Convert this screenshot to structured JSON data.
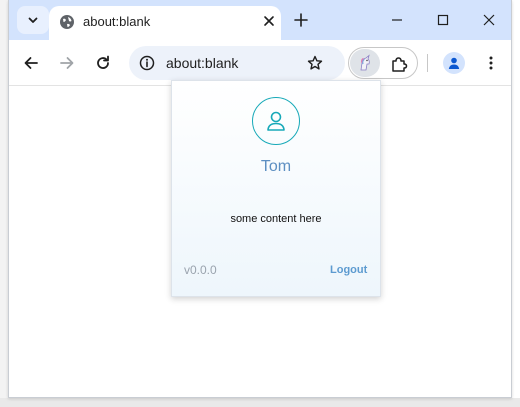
{
  "browser": {
    "tab": {
      "title": "about:blank",
      "icon": "globe-icon"
    },
    "omnibox": {
      "url": "about:blank"
    },
    "toolbar_icons": {
      "back": "arrow-left-icon",
      "forward": "arrow-right-icon",
      "reload": "reload-icon",
      "site_info": "info-icon",
      "bookmark": "star-icon",
      "extension": "unicorn-extension-icon",
      "extensions_menu": "puzzle-icon",
      "profile": "person-icon",
      "menu": "kebab-menu-icon"
    }
  },
  "popup": {
    "user_name": "Tom",
    "content_text": "some content here",
    "version": "v0.0.0",
    "logout_label": "Logout"
  },
  "colors": {
    "tabstrip_bg": "#d3e3fd",
    "accent_teal": "#17a9b8",
    "name_blue": "#5d8fc2",
    "link_blue": "#5d9bd0"
  }
}
